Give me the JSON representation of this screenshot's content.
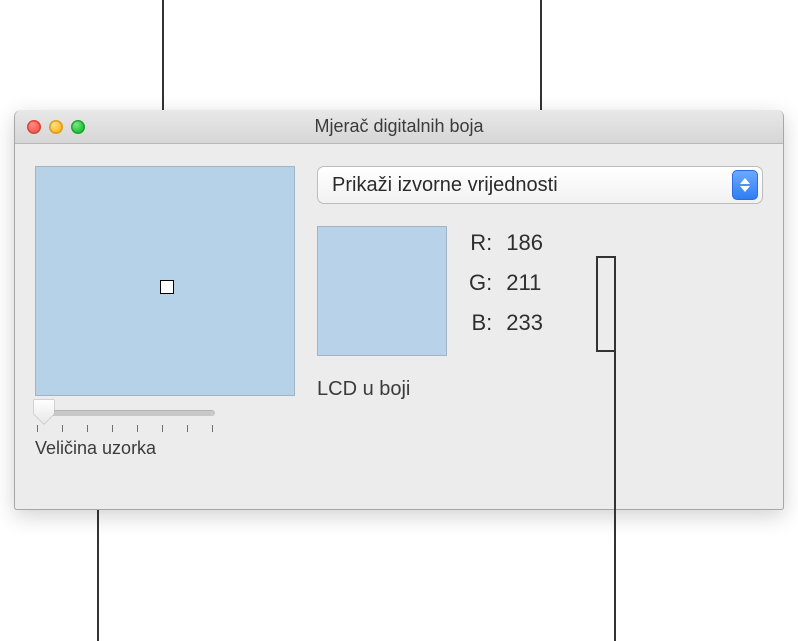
{
  "callouts": {
    "aperture": true,
    "modeSelect": true,
    "slider": true,
    "rgbValues": true
  },
  "window": {
    "title": "Mjerač digitalnih boja"
  },
  "aperture": {
    "sampledColor": "#b5d2e8"
  },
  "slider": {
    "label": "Veličina uzorka",
    "value": 0,
    "min": 0,
    "max": 7
  },
  "modeSelect": {
    "selected": "Prikaži izvorne vrijednosti"
  },
  "swatch": {
    "color": "#b8d3e9"
  },
  "rgb": {
    "rLabel": "R:",
    "gLabel": "G:",
    "bLabel": "B:",
    "r": "186",
    "g": "211",
    "b": "233"
  },
  "displayProfile": "LCD u boji"
}
